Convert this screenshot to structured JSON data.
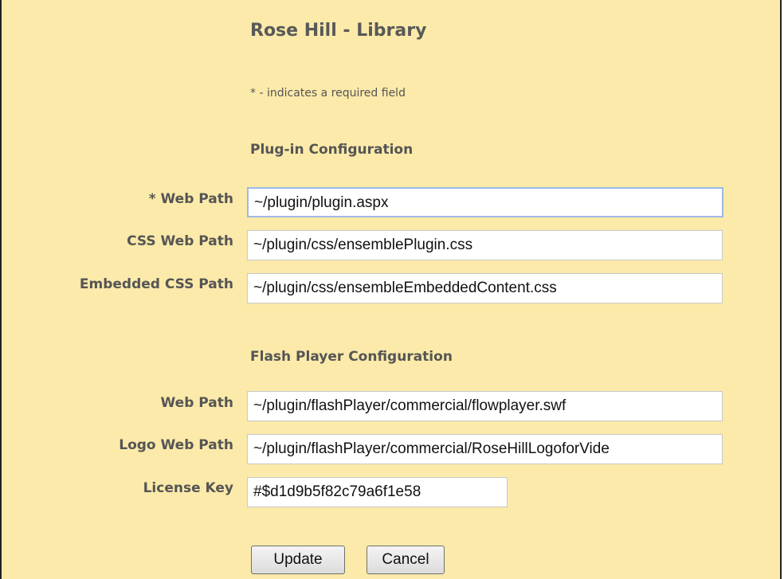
{
  "title": "Rose Hill - Library",
  "required_note": "* - indicates a required field",
  "plugin_config": {
    "heading": "Plug-in Configuration",
    "web_path": {
      "label": "* Web Path",
      "value": "~/plugin/plugin.aspx"
    },
    "css_web_path": {
      "label": "CSS Web Path",
      "value": "~/plugin/css/ensemblePlugin.css"
    },
    "embedded_css_path": {
      "label": "Embedded CSS Path",
      "value": "~/plugin/css/ensembleEmbeddedContent.css"
    }
  },
  "flash_config": {
    "heading": "Flash Player Configuration",
    "web_path": {
      "label": "Web Path",
      "value": "~/plugin/flashPlayer/commercial/flowplayer.swf"
    },
    "logo_web_path": {
      "label": "Logo Web Path",
      "value": "~/plugin/flashPlayer/commercial/RoseHillLogoforVide"
    },
    "license_key": {
      "label": "License Key",
      "value": "#$d1d9b5f82c79a6f1e58"
    }
  },
  "buttons": {
    "update": "Update",
    "cancel": "Cancel"
  }
}
